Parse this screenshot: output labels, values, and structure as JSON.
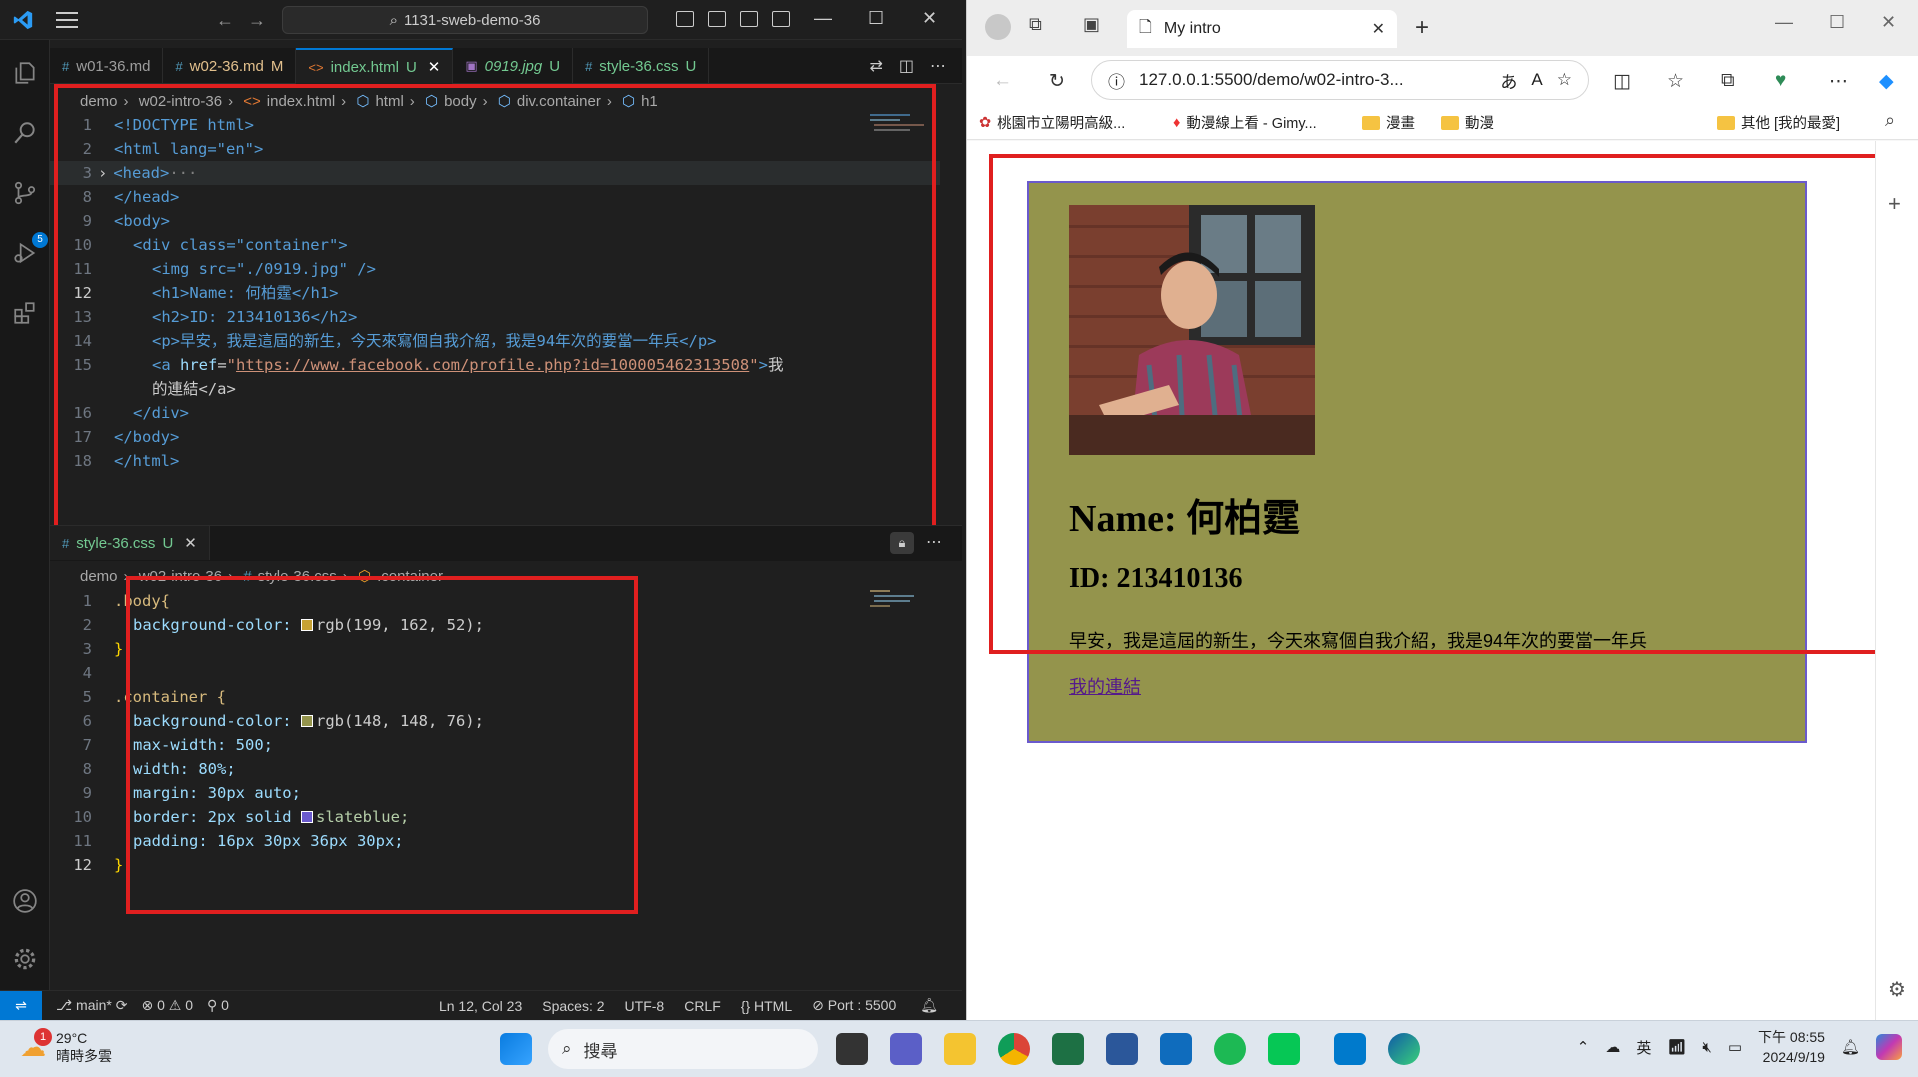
{
  "vscode": {
    "search_text": "1131-sweb-demo-36",
    "tabs": [
      {
        "label": "w01-36.md",
        "flag": "",
        "icon": "#"
      },
      {
        "label": "w02-36.md",
        "flag": "M",
        "icon": "#"
      },
      {
        "label": "index.html",
        "flag": "U",
        "icon": "<>"
      },
      {
        "label": "0919.jpg",
        "flag": "U",
        "icon": "▣"
      },
      {
        "label": "style-36.css",
        "flag": "U",
        "icon": "#"
      }
    ],
    "breadcrumb_top": [
      "demo",
      "w02-intro-36",
      "index.html",
      "html",
      "body",
      "div.container",
      "h1"
    ],
    "split_tab": {
      "label": "style-36.css",
      "flag": "U",
      "icon": "#"
    },
    "breadcrumb_bottom": [
      "demo",
      "w02-intro-36",
      "style-36.css",
      ".container"
    ],
    "activity_badge": "5",
    "html_line_numbers": [
      "1",
      "2",
      "3",
      "8",
      "9",
      "10",
      "11",
      "12",
      "13",
      "14",
      "15",
      "",
      "16",
      "17",
      "18"
    ],
    "html_text": {
      "doctype": "<!DOCTYPE html>",
      "html_open": "<html lang=\"en\">",
      "head": "<head>",
      "head_ellipsis": "···",
      "head_close": "</head>",
      "body_open": "<body>",
      "div_open": "<div class=\"container\">",
      "img": "<img src=\"./0919.jpg\" />",
      "h1": "<h1>Name: 何柏霆</h1>",
      "h2": "<h2>ID: 213410136</h2>",
      "p": "<p>早安，我是這屆的新生，今天來寫個自我介紹，我是94年次的要當一年兵</p>",
      "a_href": "https://www.facebook.com/profile.php?id=100005462313508",
      "a_text1": "我",
      "a_text2": "的連結</a>",
      "div_close": "</div>",
      "body_close": "</body>",
      "html_close": "</html>"
    },
    "css_line_numbers": [
      "1",
      "2",
      "3",
      "4",
      "5",
      "6",
      "7",
      "8",
      "9",
      "10",
      "11",
      "12"
    ],
    "css_text": {
      "l1": ".body{",
      "l2_prop": "background-color: ",
      "l2_val": "rgb(199, 162, 52);",
      "l3": "}",
      "l5": ".container {",
      "l6_prop": "background-color: ",
      "l6_val": "rgb(148, 148, 76);",
      "l7": "max-width: 500;",
      "l8": "width: 80%;",
      "l9": "margin: 30px auto;",
      "l10_prop": "border: 2px solid ",
      "l10_val": "slateblue;",
      "l11": "padding: 16px 30px 36px 30px;",
      "l12": "}"
    },
    "colors": {
      "swatch1": "#c7a234",
      "swatch2": "#94944c",
      "swatch3": "#6a5acd"
    },
    "status": {
      "branch": "main*",
      "errors": "0",
      "warnings": "0",
      "ports": "0",
      "cursor": "Ln 12, Col 23",
      "spaces": "Spaces: 2",
      "encoding": "UTF-8",
      "eol": "CRLF",
      "language": "HTML",
      "port_live": "Port : 5500"
    }
  },
  "edge": {
    "tab_title": "My intro",
    "url": "127.0.0.1:5500/demo/w02-intro-3...",
    "favorites": [
      "桃園市立陽明高級...",
      "動漫線上看 - Gimy...",
      "漫畫",
      "動漫"
    ],
    "favorites_other": "其他 [我的最愛]",
    "page": {
      "h1": "Name: 何柏霆",
      "h2": "ID: 213410136",
      "p": "早安，我是這屆的新生，今天來寫個自我介紹，我是94年次的要當一年兵",
      "link": "我的連結",
      "container_bg": "#94944c",
      "container_border": "#6a5acd"
    }
  },
  "taskbar": {
    "weather_temp": "29°C",
    "weather_desc": "晴時多雲",
    "weather_badge": "1",
    "search_placeholder": "搜尋",
    "ime": "英",
    "time": "下午 08:55",
    "date": "2024/9/19"
  }
}
